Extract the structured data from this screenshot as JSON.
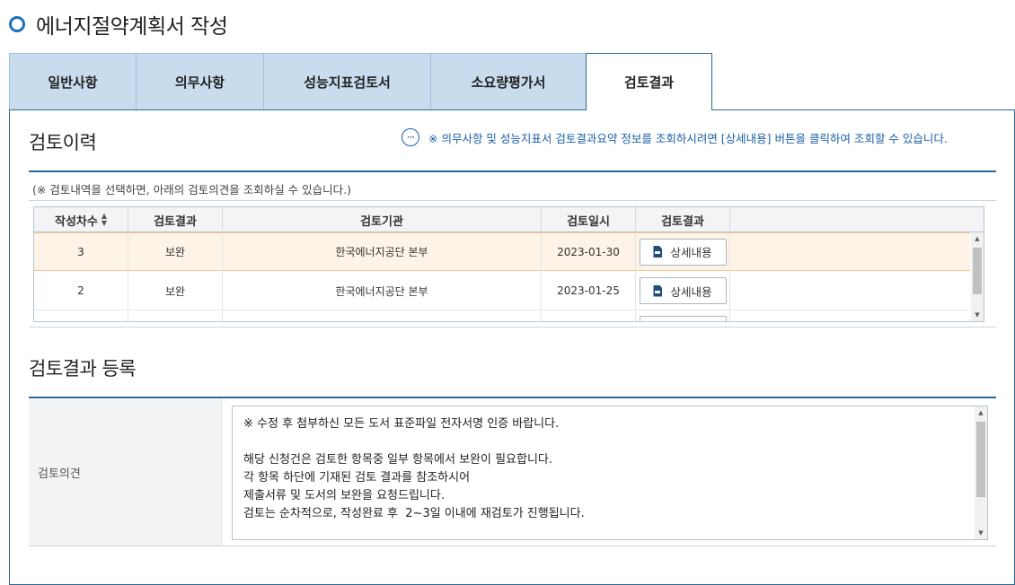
{
  "page": {
    "title": "에너지절약계획서 작성"
  },
  "tabs": [
    {
      "label": "일반사항",
      "active": false
    },
    {
      "label": "의무사항",
      "active": false
    },
    {
      "label": "성능지표검토서",
      "active": false
    },
    {
      "label": "소요량평가서",
      "active": false
    },
    {
      "label": "검토결과",
      "active": true
    }
  ],
  "review_history": {
    "title": "검토이력",
    "notice": "※ 의무사항 및 성능지표서 검토결과요약 정보를 조회하시려면 [상세내용] 버튼을 클릭하여 조회할 수 있습니다.",
    "hint": "(※ 검토내역을 선택하면, 아래의 검토의견을 조회하실 수 있습니다.)",
    "columns": [
      "작성차수",
      "검토결과",
      "검토기관",
      "검토일시",
      "검토결과"
    ],
    "rows": [
      {
        "round": "3",
        "result": "보완",
        "agency": "한국에너지공단 본부",
        "date": "2023-01-30",
        "button": "상세내용",
        "selected": true
      },
      {
        "round": "2",
        "result": "보완",
        "agency": "한국에너지공단 본부",
        "date": "2023-01-25",
        "button": "상세내용",
        "selected": false
      }
    ]
  },
  "review_register": {
    "title": "검토결과 등록",
    "opinion_label": "검토의견",
    "opinion_text": "※ 수정 후 첨부하신 모든 도서 표준파일 전자서명 인증 바랍니다.\n\n해당 신청건은 검토한 항목중 일부 항목에서 보완이 필요합니다.\n각 항목 하단에 기재된 검토 결과를 참조하시어\n제출서류 및 도서의 보완을 요청드립니다.\n검토는 순차적으로, 작성완료 후  2~3일 이내에 재검토가 진행됩니다."
  },
  "colors": {
    "accent": "#2c6a94",
    "tab_inactive": "#c8dced",
    "notice_text": "#1a5fa6",
    "selected_row": "#fdf3e6"
  },
  "icons": {
    "title": "ring-bullet-icon",
    "notice": "more-dots-icon",
    "detail": "document-icon",
    "sort": "sort-icon"
  }
}
